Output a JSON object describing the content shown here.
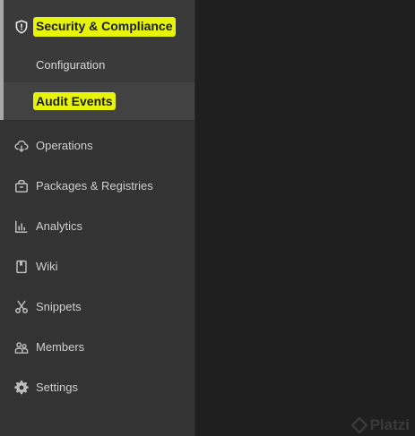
{
  "sidebar": {
    "active_section": {
      "label": "Security & Compliance",
      "icon": "shield-icon",
      "sub_items": [
        {
          "label": "Configuration",
          "active": false
        },
        {
          "label": "Audit Events",
          "active": true
        }
      ]
    },
    "items": [
      {
        "label": "Operations",
        "icon": "cloud-icon"
      },
      {
        "label": "Packages & Registries",
        "icon": "package-icon"
      },
      {
        "label": "Analytics",
        "icon": "chart-icon"
      },
      {
        "label": "Wiki",
        "icon": "book-icon"
      },
      {
        "label": "Snippets",
        "icon": "scissors-icon"
      },
      {
        "label": "Members",
        "icon": "users-icon"
      },
      {
        "label": "Settings",
        "icon": "gear-icon"
      }
    ]
  },
  "watermark": {
    "text": "Platzi"
  },
  "colors": {
    "highlight": "#e8f20a",
    "sidebar_bg": "#333333",
    "main_bg": "#1f1f1f"
  }
}
